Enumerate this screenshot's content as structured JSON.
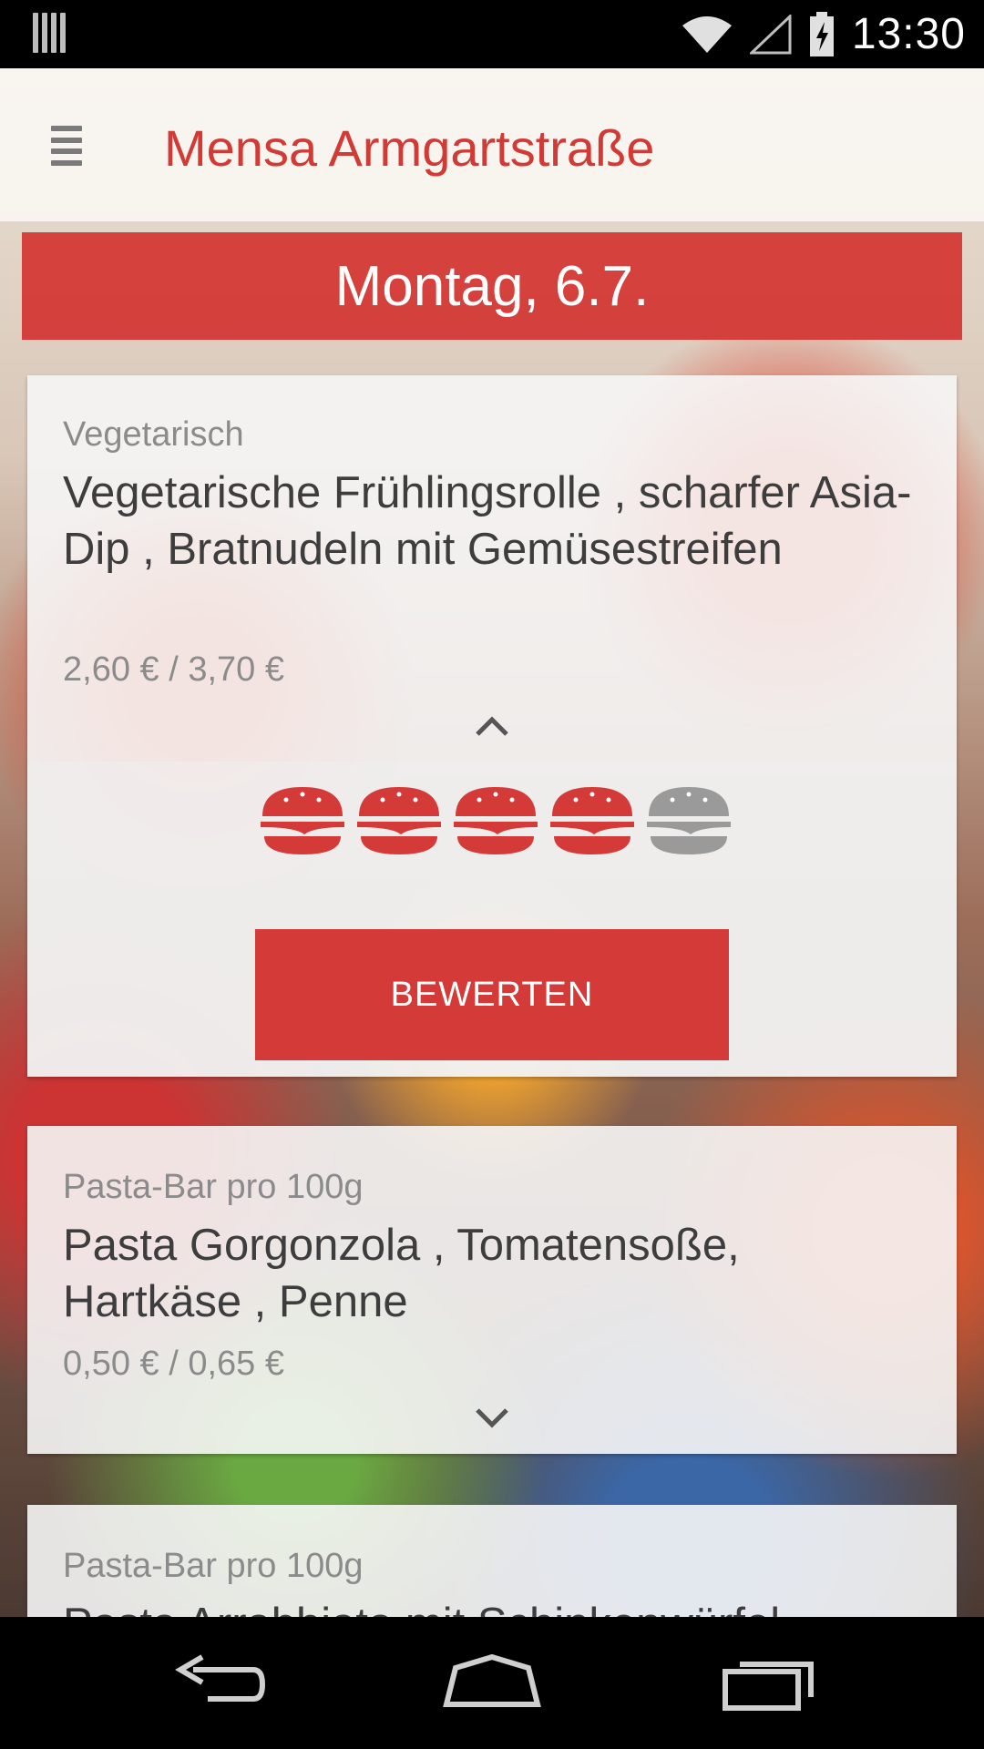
{
  "status_bar": {
    "time": "13:30"
  },
  "app_bar": {
    "title": "Mensa Armgartstraße"
  },
  "day_header": {
    "label": "Montag, 6.7."
  },
  "meals": [
    {
      "category": "Vegetarisch",
      "name": "Vegetarische Frühlingsrolle , scharfer Asia-Dip , Bratnudeln mit Gemüsestreifen",
      "price": "2,60 € / 3,70 €",
      "expanded": true,
      "rating": 4,
      "rating_max": 5,
      "rate_button_label": "BEWERTEN"
    },
    {
      "category": "Pasta-Bar pro 100g",
      "name": "Pasta Gorgonzola , Tomatensoße, Hartkäse , Penne",
      "price": "0,50 € / 0,65 €",
      "expanded": false
    },
    {
      "category": "Pasta-Bar pro 100g",
      "name": "Pasta Arrabbiata mit Schinkenwürfel",
      "price": "",
      "expanded": false
    }
  ],
  "colors": {
    "accent": "#d23a36",
    "rating_active": "#d43b38",
    "rating_inactive": "#9a9a9a"
  },
  "icons": {
    "menu": "hamburger-menu-icon",
    "collapse": "chevron-up-icon",
    "expand": "chevron-down-icon",
    "rating": "burger-icon",
    "nav_back": "back-arrow-icon",
    "nav_home": "home-icon",
    "nav_recents": "recents-icon"
  }
}
